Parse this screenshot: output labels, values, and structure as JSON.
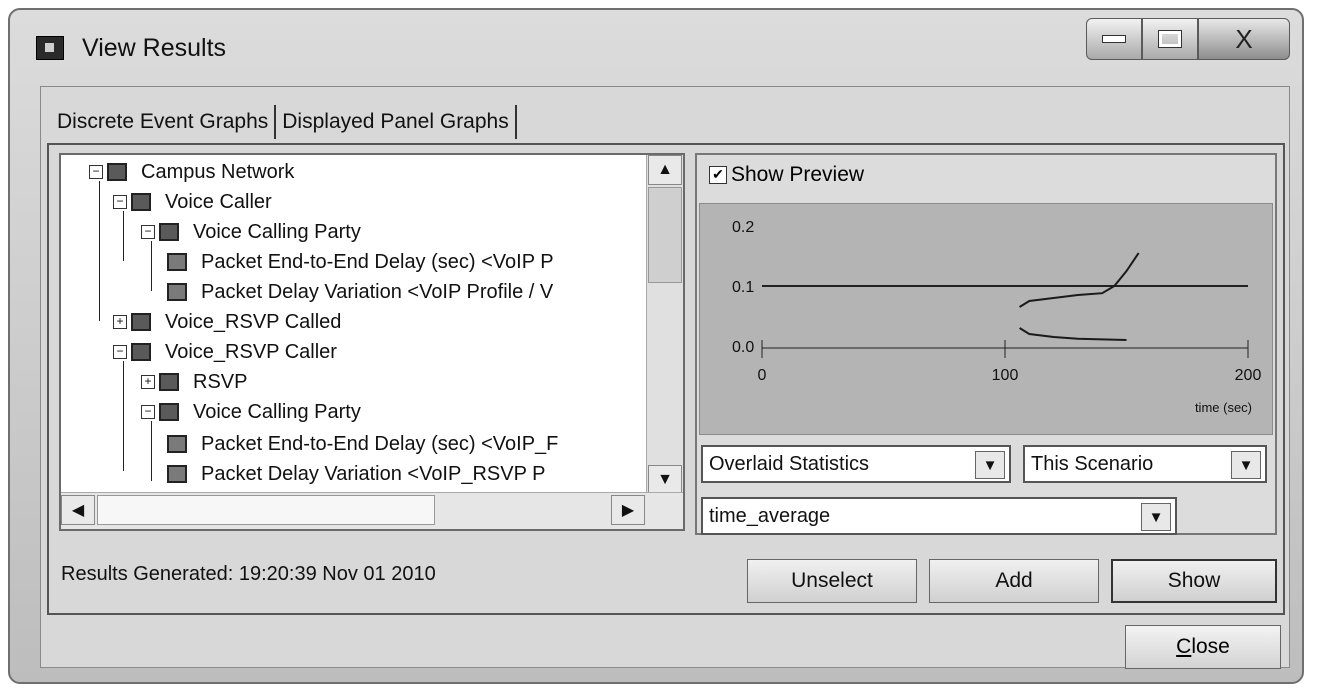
{
  "window": {
    "title": "View Results",
    "close_glyph": "X"
  },
  "tabs": [
    {
      "label": "Discrete Event Graphs"
    },
    {
      "label": "Displayed Panel Graphs"
    }
  ],
  "tree": {
    "items": [
      {
        "label": "Campus Network"
      },
      {
        "label": "Voice Caller"
      },
      {
        "label": "Voice Calling Party"
      },
      {
        "label": "Packet End-to-End Delay (sec) <VoIP P"
      },
      {
        "label": "Packet Delay Variation <VoIP Profile / V"
      },
      {
        "label": "Voice_RSVP Called"
      },
      {
        "label": "Voice_RSVP Caller"
      },
      {
        "label": "RSVP"
      },
      {
        "label": "Voice Calling Party"
      },
      {
        "label": "Packet End-to-End Delay (sec) <VoIP_F"
      },
      {
        "label": "Packet Delay Variation <VoIP_RSVP P"
      }
    ]
  },
  "preview": {
    "label": "Show Preview",
    "checked": true
  },
  "chart_data": {
    "type": "line",
    "xlabel": "time (sec)",
    "ylabel": "",
    "xlim": [
      0,
      200
    ],
    "ylim": [
      0,
      0.2
    ],
    "x_ticks": [
      "0",
      "100",
      "200"
    ],
    "y_ticks": [
      "0.2",
      "0.1",
      "0.0"
    ],
    "series": [
      {
        "x": [
          106,
          110,
          120,
          130,
          140,
          145,
          150,
          155
        ],
        "y": [
          0.065,
          0.075,
          0.08,
          0.085,
          0.088,
          0.1,
          0.125,
          0.155
        ]
      },
      {
        "x": [
          106,
          110,
          120,
          130,
          140,
          150
        ],
        "y": [
          0.03,
          0.02,
          0.015,
          0.012,
          0.011,
          0.01
        ]
      }
    ],
    "grid": false
  },
  "controls": {
    "stat_type": "Overlaid Statistics",
    "scenario": "This Scenario",
    "filter": "time_average"
  },
  "status": "Results Generated: 19:20:39 Nov 01 2010",
  "buttons": {
    "unselect": "Unselect",
    "add": "Add",
    "show": "Show"
  },
  "close": {
    "prefix": "",
    "mnemonic": "C",
    "rest": "lose"
  }
}
